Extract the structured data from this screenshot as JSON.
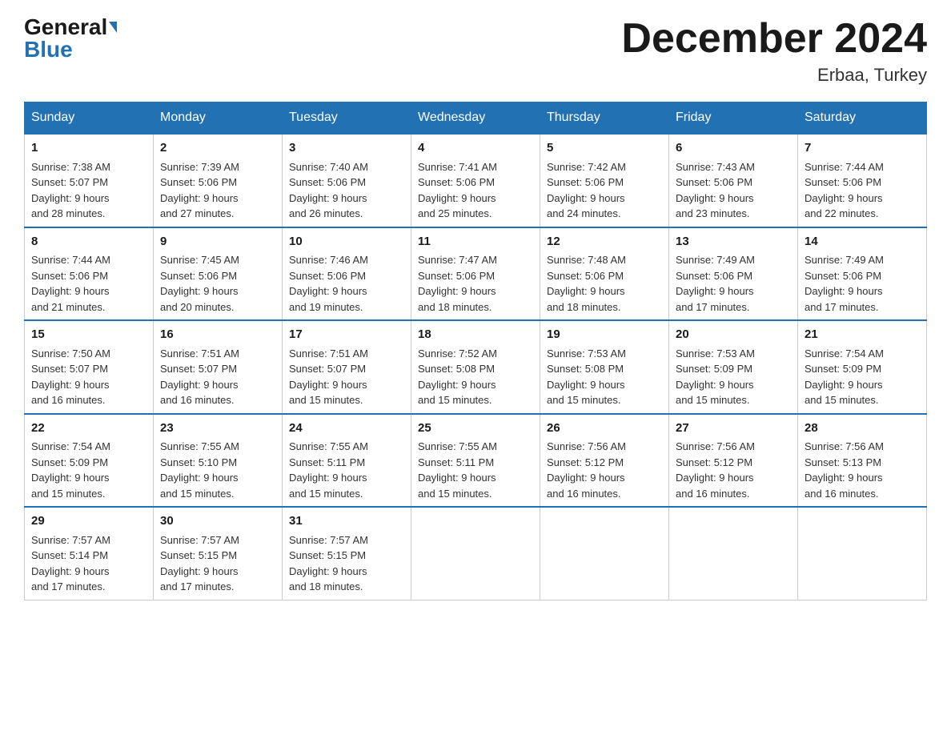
{
  "header": {
    "logo_general": "General",
    "logo_blue": "Blue",
    "month_title": "December 2024",
    "location": "Erbaa, Turkey"
  },
  "weekdays": [
    "Sunday",
    "Monday",
    "Tuesday",
    "Wednesday",
    "Thursday",
    "Friday",
    "Saturday"
  ],
  "weeks": [
    [
      {
        "day": "1",
        "sunrise": "7:38 AM",
        "sunset": "5:07 PM",
        "daylight": "9 hours and 28 minutes."
      },
      {
        "day": "2",
        "sunrise": "7:39 AM",
        "sunset": "5:06 PM",
        "daylight": "9 hours and 27 minutes."
      },
      {
        "day": "3",
        "sunrise": "7:40 AM",
        "sunset": "5:06 PM",
        "daylight": "9 hours and 26 minutes."
      },
      {
        "day": "4",
        "sunrise": "7:41 AM",
        "sunset": "5:06 PM",
        "daylight": "9 hours and 25 minutes."
      },
      {
        "day": "5",
        "sunrise": "7:42 AM",
        "sunset": "5:06 PM",
        "daylight": "9 hours and 24 minutes."
      },
      {
        "day": "6",
        "sunrise": "7:43 AM",
        "sunset": "5:06 PM",
        "daylight": "9 hours and 23 minutes."
      },
      {
        "day": "7",
        "sunrise": "7:44 AM",
        "sunset": "5:06 PM",
        "daylight": "9 hours and 22 minutes."
      }
    ],
    [
      {
        "day": "8",
        "sunrise": "7:44 AM",
        "sunset": "5:06 PM",
        "daylight": "9 hours and 21 minutes."
      },
      {
        "day": "9",
        "sunrise": "7:45 AM",
        "sunset": "5:06 PM",
        "daylight": "9 hours and 20 minutes."
      },
      {
        "day": "10",
        "sunrise": "7:46 AM",
        "sunset": "5:06 PM",
        "daylight": "9 hours and 19 minutes."
      },
      {
        "day": "11",
        "sunrise": "7:47 AM",
        "sunset": "5:06 PM",
        "daylight": "9 hours and 18 minutes."
      },
      {
        "day": "12",
        "sunrise": "7:48 AM",
        "sunset": "5:06 PM",
        "daylight": "9 hours and 18 minutes."
      },
      {
        "day": "13",
        "sunrise": "7:49 AM",
        "sunset": "5:06 PM",
        "daylight": "9 hours and 17 minutes."
      },
      {
        "day": "14",
        "sunrise": "7:49 AM",
        "sunset": "5:06 PM",
        "daylight": "9 hours and 17 minutes."
      }
    ],
    [
      {
        "day": "15",
        "sunrise": "7:50 AM",
        "sunset": "5:07 PM",
        "daylight": "9 hours and 16 minutes."
      },
      {
        "day": "16",
        "sunrise": "7:51 AM",
        "sunset": "5:07 PM",
        "daylight": "9 hours and 16 minutes."
      },
      {
        "day": "17",
        "sunrise": "7:51 AM",
        "sunset": "5:07 PM",
        "daylight": "9 hours and 15 minutes."
      },
      {
        "day": "18",
        "sunrise": "7:52 AM",
        "sunset": "5:08 PM",
        "daylight": "9 hours and 15 minutes."
      },
      {
        "day": "19",
        "sunrise": "7:53 AM",
        "sunset": "5:08 PM",
        "daylight": "9 hours and 15 minutes."
      },
      {
        "day": "20",
        "sunrise": "7:53 AM",
        "sunset": "5:09 PM",
        "daylight": "9 hours and 15 minutes."
      },
      {
        "day": "21",
        "sunrise": "7:54 AM",
        "sunset": "5:09 PM",
        "daylight": "9 hours and 15 minutes."
      }
    ],
    [
      {
        "day": "22",
        "sunrise": "7:54 AM",
        "sunset": "5:09 PM",
        "daylight": "9 hours and 15 minutes."
      },
      {
        "day": "23",
        "sunrise": "7:55 AM",
        "sunset": "5:10 PM",
        "daylight": "9 hours and 15 minutes."
      },
      {
        "day": "24",
        "sunrise": "7:55 AM",
        "sunset": "5:11 PM",
        "daylight": "9 hours and 15 minutes."
      },
      {
        "day": "25",
        "sunrise": "7:55 AM",
        "sunset": "5:11 PM",
        "daylight": "9 hours and 15 minutes."
      },
      {
        "day": "26",
        "sunrise": "7:56 AM",
        "sunset": "5:12 PM",
        "daylight": "9 hours and 16 minutes."
      },
      {
        "day": "27",
        "sunrise": "7:56 AM",
        "sunset": "5:12 PM",
        "daylight": "9 hours and 16 minutes."
      },
      {
        "day": "28",
        "sunrise": "7:56 AM",
        "sunset": "5:13 PM",
        "daylight": "9 hours and 16 minutes."
      }
    ],
    [
      {
        "day": "29",
        "sunrise": "7:57 AM",
        "sunset": "5:14 PM",
        "daylight": "9 hours and 17 minutes."
      },
      {
        "day": "30",
        "sunrise": "7:57 AM",
        "sunset": "5:15 PM",
        "daylight": "9 hours and 17 minutes."
      },
      {
        "day": "31",
        "sunrise": "7:57 AM",
        "sunset": "5:15 PM",
        "daylight": "9 hours and 18 minutes."
      },
      null,
      null,
      null,
      null
    ]
  ],
  "labels": {
    "sunrise": "Sunrise:",
    "sunset": "Sunset:",
    "daylight": "Daylight:"
  }
}
